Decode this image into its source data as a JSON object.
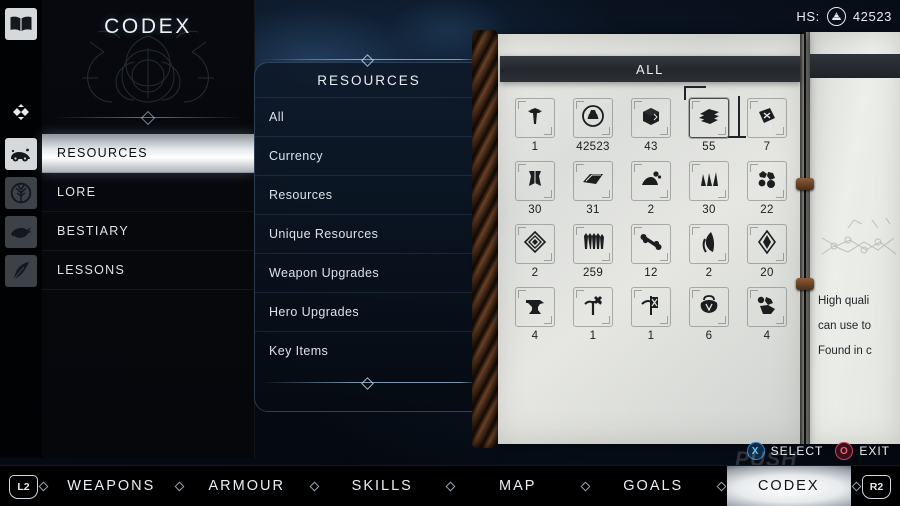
{
  "header": {
    "title": "CODEX",
    "hs_label": "HS:",
    "hs_value": "42523",
    "hs_icon": "shards-coin-icon"
  },
  "rail": {
    "items": [
      {
        "name": "codex-book",
        "icon": "open-book-icon",
        "state": "light"
      },
      {
        "name": "dpad",
        "icon": "dpad-icon",
        "state": "plain"
      },
      {
        "name": "resources",
        "icon": "resources-icon",
        "state": "light"
      },
      {
        "name": "lore",
        "icon": "tree-icon",
        "state": "dim"
      },
      {
        "name": "bestiary",
        "icon": "beast-icon",
        "state": "dim"
      },
      {
        "name": "lessons",
        "icon": "quill-icon",
        "state": "dim"
      }
    ]
  },
  "nav": {
    "items": [
      {
        "label": "RESOURCES",
        "selected": true
      },
      {
        "label": "LORE",
        "selected": false
      },
      {
        "label": "BESTIARY",
        "selected": false
      },
      {
        "label": "LESSONS",
        "selected": false
      }
    ]
  },
  "resources_panel": {
    "title": "RESOURCES",
    "items": [
      {
        "label": "All"
      },
      {
        "label": "Currency"
      },
      {
        "label": "Resources"
      },
      {
        "label": "Unique Resources"
      },
      {
        "label": "Weapon Upgrades"
      },
      {
        "label": "Hero Upgrades"
      },
      {
        "label": "Key Items"
      }
    ]
  },
  "book": {
    "banner_label": "ALL",
    "items": [
      {
        "icon": "hammer-icon",
        "qty": "1",
        "selected": false
      },
      {
        "icon": "ingot-coin-icon",
        "qty": "42523",
        "selected": false
      },
      {
        "icon": "crate-icon",
        "qty": "43",
        "selected": false
      },
      {
        "icon": "planks-icon",
        "qty": "55",
        "selected": true
      },
      {
        "icon": "book-x-icon",
        "qty": "7",
        "selected": false
      },
      {
        "icon": "hide-icon",
        "qty": "30",
        "selected": false
      },
      {
        "icon": "metal-bar-icon",
        "qty": "31",
        "selected": false
      },
      {
        "icon": "ore-pile-icon",
        "qty": "2",
        "selected": false
      },
      {
        "icon": "shards-icon",
        "qty": "30",
        "selected": false
      },
      {
        "icon": "stones-icon",
        "qty": "22",
        "selected": false
      },
      {
        "icon": "rune-gem-icon",
        "qty": "2",
        "selected": false
      },
      {
        "icon": "arrows-icon",
        "qty": "259",
        "selected": false
      },
      {
        "icon": "bone-icon",
        "qty": "12",
        "selected": false
      },
      {
        "icon": "feather-icon",
        "qty": "2",
        "selected": false
      },
      {
        "icon": "crystal-icon",
        "qty": "20",
        "selected": false
      },
      {
        "icon": "anvil-icon",
        "qty": "4",
        "selected": false
      },
      {
        "icon": "totem-icon",
        "qty": "1",
        "selected": false
      },
      {
        "icon": "banner-icon",
        "qty": "1",
        "selected": false
      },
      {
        "icon": "pouch-icon",
        "qty": "6",
        "selected": false
      },
      {
        "icon": "rocks-icon",
        "qty": "4",
        "selected": false
      }
    ],
    "right_page": {
      "paragraph1": "High quali",
      "paragraph2": "can use to",
      "paragraph3": "Found in c"
    }
  },
  "prompts": [
    {
      "button": "X",
      "label": "SELECT",
      "icon": "cross-button-icon"
    },
    {
      "button": "O",
      "label": "EXIT",
      "icon": "circle-button-icon"
    }
  ],
  "bottom_bar": {
    "left_shoulder": "L2",
    "right_shoulder": "R2",
    "tabs": [
      {
        "label": "WEAPONS",
        "active": false
      },
      {
        "label": "ARMOUR",
        "active": false
      },
      {
        "label": "SKILLS",
        "active": false
      },
      {
        "label": "MAP",
        "active": false
      },
      {
        "label": "GOALS",
        "active": false
      },
      {
        "label": "CODEX",
        "active": true
      }
    ]
  },
  "watermark": "PUSH",
  "colors": {
    "accent_blue": "#6cc0f0",
    "accent_red": "#ef5f7c",
    "panel_bg": "#0c1724",
    "page": "#e6e7e3"
  }
}
